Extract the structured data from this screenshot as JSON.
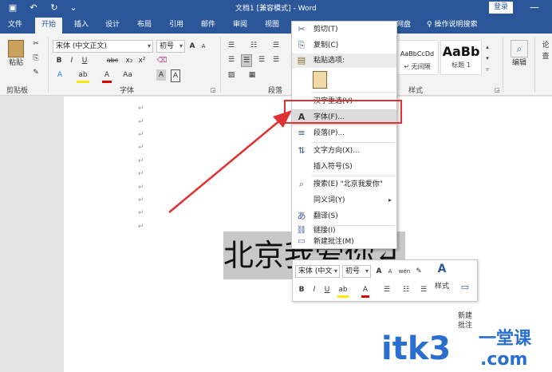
{
  "titlebar": {
    "title": "文档1 [兼容模式] - Word",
    "login": "登录",
    "save_icon": "▣",
    "undo_icon": "↶",
    "redo_icon": "↻",
    "more_icon": "⌄",
    "minimize_icon": "—"
  },
  "tabs": [
    "文件",
    "开始",
    "插入",
    "设计",
    "布局",
    "引用",
    "邮件",
    "审阅",
    "视图",
    "网盘"
  ],
  "tell_me": "操作说明搜索",
  "ribbon": {
    "clipboard": {
      "paste": "粘贴",
      "label": "剪贴板"
    },
    "font": {
      "name": "宋体 (中文正文)",
      "size": "初号",
      "label": "字体",
      "bold": "B",
      "italic": "I",
      "underline": "U",
      "strike": "abc",
      "sub": "x₂",
      "sup": "x²",
      "grow": "A",
      "shrink": "A",
      "aa": "Aa",
      "font_color": "A",
      "highlight": "ab",
      "char_border": "A",
      "char_shade": "A"
    },
    "paragraph": {
      "label": "段落"
    },
    "styles": {
      "label": "样式",
      "items": [
        {
          "sample": "AaBbCcDd",
          "name": "↵ 无间隔"
        },
        {
          "sample": "AaBb",
          "name": "标题 1"
        }
      ]
    },
    "editing": {
      "label": "编辑"
    },
    "extra": {
      "label": "论\n查"
    }
  },
  "document": {
    "selected_text": "北京我爱你↵",
    "para_mark": "↵"
  },
  "context_menu": {
    "items": [
      {
        "icon": "✂",
        "label": "剪切(T)"
      },
      {
        "icon": "⎘",
        "label": "复制(C)"
      },
      {
        "icon": "",
        "label": "粘贴选项:"
      },
      {
        "icon": "📋",
        "label": ""
      },
      {
        "icon": "",
        "label": "汉字重选(V)"
      },
      {
        "icon": "A",
        "label": "字体(F)..."
      },
      {
        "icon": "≡",
        "label": "段落(P)..."
      },
      {
        "icon": "⇅",
        "label": "文字方向(X)..."
      },
      {
        "icon": "",
        "label": "插入符号(S)"
      },
      {
        "icon": "⌕",
        "label": "搜索(E) \"北京我爱你\""
      },
      {
        "icon": "",
        "label": "同义词(Y)",
        "sub": "▸"
      },
      {
        "icon": "あ",
        "label": "翻译(S)"
      },
      {
        "icon": "🔗",
        "label": "链接(I)"
      },
      {
        "icon": "💬",
        "label": "新建批注(M)"
      }
    ]
  },
  "mini_toolbar": {
    "font": "宋体 (中文",
    "size": "初号",
    "grow": "A",
    "shrink": "A",
    "pinyin": "wén",
    "brush": "✎",
    "style_label": "样式",
    "comment_label": "新建\n批注",
    "bold": "B",
    "italic": "I",
    "underline": "U",
    "highlight": "ab",
    "font_color": "A"
  },
  "watermark": {
    "text": "itk3",
    "cn": "一堂课",
    "dot": ".com"
  },
  "colors": {
    "brand": "#2b579a",
    "annotation": "#e03131",
    "watermark": "#2a6fcf"
  }
}
